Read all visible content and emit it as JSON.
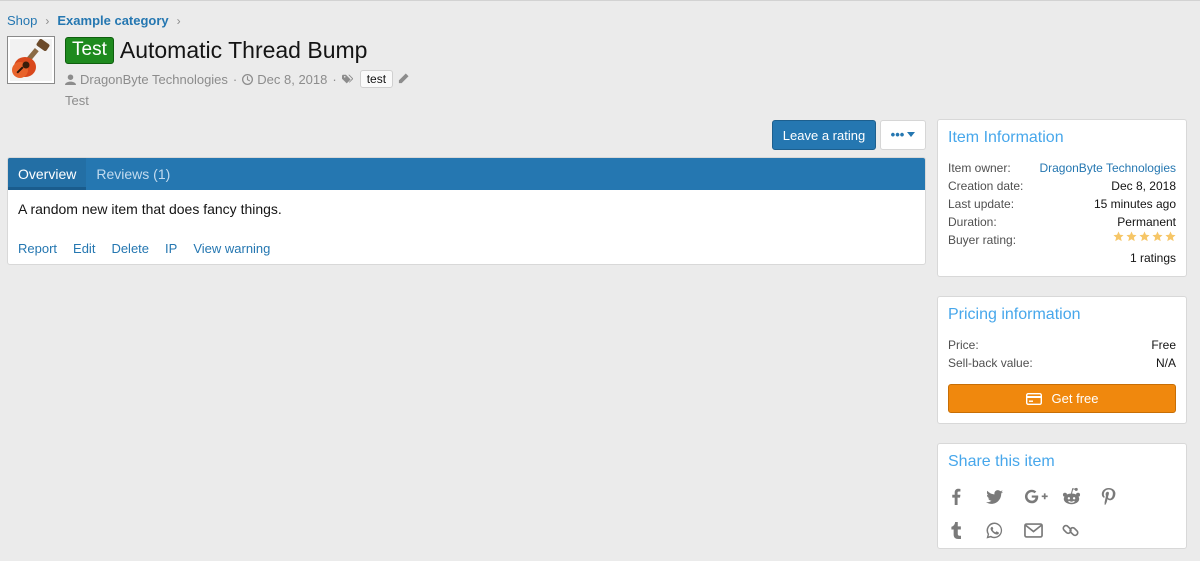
{
  "breadcrumb": [
    {
      "label": "Shop"
    },
    {
      "label": "Example category"
    }
  ],
  "item": {
    "icon": "guitar-icon",
    "prefix_label": "Test",
    "title": "Automatic Thread Bump",
    "author": "DragonByte Technologies",
    "date": "Dec 8, 2018",
    "tag": "test",
    "tagline": "Test"
  },
  "actions_bar": {
    "leave_rating": "Leave a rating",
    "more_icon": "ellipsis-dropdown-icon"
  },
  "tabs": [
    {
      "label": "Overview",
      "active": true
    },
    {
      "label": "Reviews (1)",
      "active": false
    }
  ],
  "description": "A random new item that does fancy things.",
  "content_actions": [
    "Report",
    "Edit",
    "Delete",
    "IP",
    "View warning"
  ],
  "item_information": {
    "title": "Item Information",
    "owner_label": "Item owner:",
    "owner_value": "DragonByte Technologies",
    "created_label": "Creation date:",
    "created_value": "Dec 8, 2018",
    "updated_label": "Last update:",
    "updated_value": "15 minutes ago",
    "duration_label": "Duration:",
    "duration_value": "Permanent",
    "rating_label": "Buyer rating:",
    "rating_stars": 5,
    "ratings_count": "1 ratings"
  },
  "pricing": {
    "title": "Pricing information",
    "price_label": "Price:",
    "price_value": "Free",
    "sellback_label": "Sell-back value:",
    "sellback_value": "N/A",
    "button": "Get free",
    "button_color": "#f0880d"
  },
  "share": {
    "title": "Share this item",
    "icons": [
      "facebook-icon",
      "twitter-icon",
      "google-plus-icon",
      "reddit-icon",
      "pinterest-icon",
      "tumblr-icon",
      "whatsapp-icon",
      "email-icon",
      "link-icon"
    ]
  },
  "colors": {
    "accent": "#2577b1",
    "badge_green": "#1e8a1e",
    "sidebar_title": "#47a7eb",
    "star": "#f6c667"
  }
}
